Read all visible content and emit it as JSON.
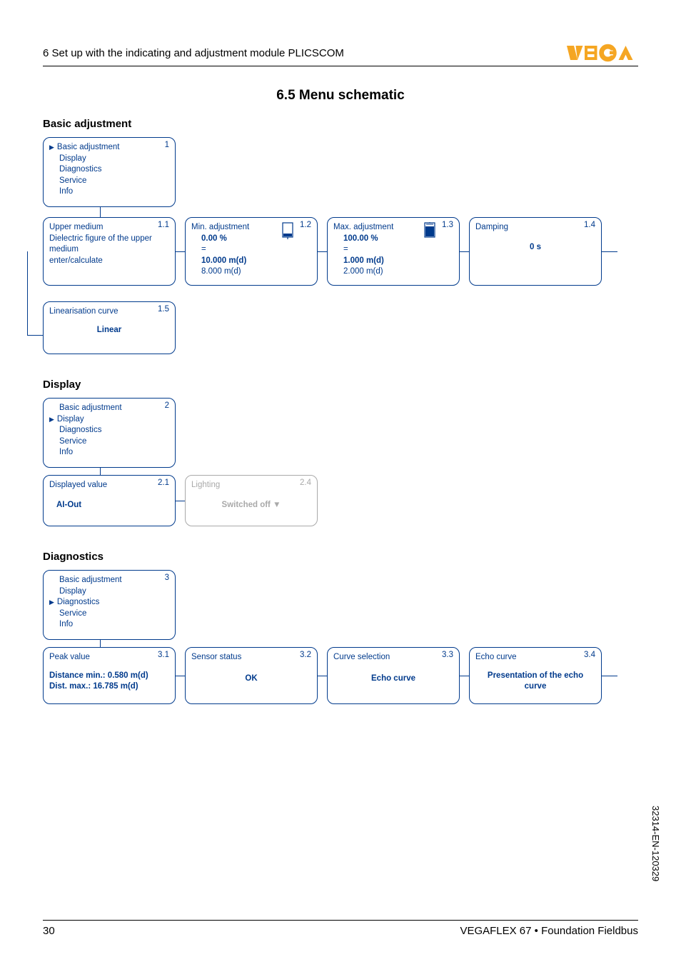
{
  "header": {
    "chapter": "6  Set up with the indicating and adjustment module PLICSCOM",
    "logo_text": "VEGA"
  },
  "title": "6.5   Menu schematic",
  "sections": {
    "basic": {
      "heading": "Basic adjustment",
      "menu": {
        "num": "1",
        "items": [
          "Basic adjustment",
          "Display",
          "Diagnostics",
          "Service",
          "Info"
        ],
        "selected_index": 0
      },
      "boxes": {
        "b11": {
          "num": "1.1",
          "title": "Upper medium",
          "l1": "Dielectric figure of the upper medium",
          "l2": "enter/calculate"
        },
        "b12": {
          "num": "1.2",
          "title": "Min. adjustment",
          "l1": "0.00 %",
          "l2": "=",
          "l3": "10.000 m(d)",
          "l4": "8.000 m(d)"
        },
        "b13": {
          "num": "1.3",
          "title": "Max. adjustment",
          "l1": "100.00 %",
          "l2": "=",
          "l3": "1.000 m(d)",
          "l4": "2.000 m(d)"
        },
        "b14": {
          "num": "1.4",
          "title": "Damping",
          "l1": "0 s"
        },
        "b15": {
          "num": "1.5",
          "title": "Linearisation curve",
          "l1": "Linear"
        }
      }
    },
    "display": {
      "heading": "Display",
      "menu": {
        "num": "2",
        "items": [
          "Basic adjustment",
          "Display",
          "Diagnostics",
          "Service",
          "Info"
        ],
        "selected_index": 1
      },
      "boxes": {
        "b21": {
          "num": "2.1",
          "title": "Displayed value",
          "l1": "AI-Out"
        },
        "b24": {
          "num": "2.4",
          "title": "Lighting",
          "l1": "Switched off ▼"
        }
      }
    },
    "diag": {
      "heading": "Diagnostics",
      "menu": {
        "num": "3",
        "items": [
          "Basic adjustment",
          "Display",
          "Diagnostics",
          "Service",
          "Info"
        ],
        "selected_index": 2
      },
      "boxes": {
        "b31": {
          "num": "3.1",
          "title": "Peak value",
          "l1": "Distance min.: 0.580 m(d)",
          "l2": "Dist. max.: 16.785 m(d)"
        },
        "b32": {
          "num": "3.2",
          "title": "Sensor status",
          "l1": "OK"
        },
        "b33": {
          "num": "3.3",
          "title": "Curve selection",
          "l1": "Echo curve"
        },
        "b34": {
          "num": "3.4",
          "title": "Echo curve",
          "l1": "Presentation of the echo curve"
        }
      }
    }
  },
  "footer": {
    "page": "30",
    "product": "VEGAFLEX 67 • Foundation Fieldbus"
  },
  "side_code": "32314-EN-120329"
}
